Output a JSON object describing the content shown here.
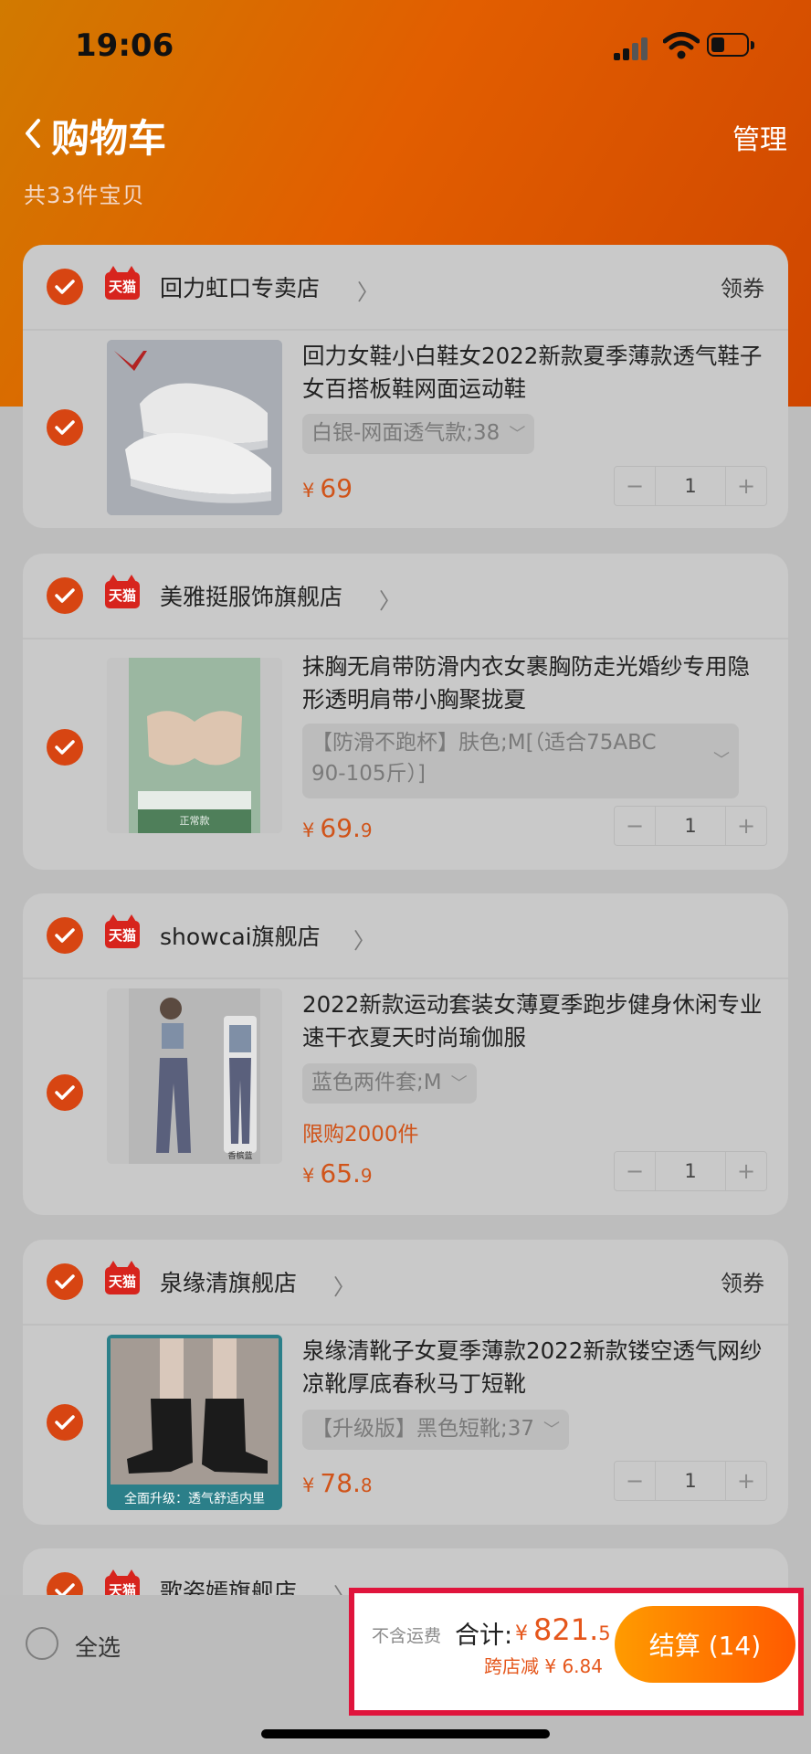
{
  "status_bar": {
    "time": "19:06"
  },
  "header": {
    "title": "购物车",
    "manage": "管理",
    "item_count": "共33件宝贝"
  },
  "shops": [
    {
      "name": "回力虹口专卖店",
      "badge": "天猫",
      "coupon": "领券",
      "item": {
        "title": "回力女鞋小白鞋女2022新款夏季薄款透气鞋子女百搭板鞋网面运动鞋",
        "spec": "白银-网面透气款;38",
        "price_symbol": "¥",
        "price_int": "69",
        "price_dec": "",
        "quantity": "1"
      }
    },
    {
      "name": "美雅挺服饰旗舰店",
      "badge": "天猫",
      "item": {
        "title": "抹胸无肩带防滑内衣女裹胸防走光婚纱专用隐形透明肩带小胸聚拢夏",
        "spec": "【防滑不跑杯】肤色;M[（适合75ABC 90-105斤）]",
        "price_symbol": "¥",
        "price_int": "69.",
        "price_dec": "9",
        "quantity": "1",
        "image_caption": "正常款"
      }
    },
    {
      "name": "showcai旗舰店",
      "badge": "天猫",
      "item": {
        "title": "2022新款运动套装女薄夏季跑步健身休闲专业速干衣夏天时尚瑜伽服",
        "spec": "蓝色两件套;M",
        "limit": "限购2000件",
        "price_symbol": "¥",
        "price_int": "65.",
        "price_dec": "9",
        "quantity": "1",
        "image_caption": "香槟蓝"
      }
    },
    {
      "name": "泉缘清旗舰店",
      "badge": "天猫",
      "coupon": "领券",
      "item": {
        "title": "泉缘清靴子女夏季薄款2022新款镂空透气网纱凉靴厚底春秋马丁短靴",
        "spec": "【升级版】黑色短靴;37",
        "price_symbol": "¥",
        "price_int": "78.",
        "price_dec": "8",
        "quantity": "1",
        "image_caption": "全面升级：透气舒适内里"
      }
    },
    {
      "name": "歌姿嫣旗舰店",
      "badge": "天猫"
    }
  ],
  "stepper": {
    "minus": "−",
    "plus": "+"
  },
  "bottom_bar": {
    "select_all": "全选",
    "shipping_note": "不含运费",
    "total_label": "合计:",
    "total_symbol": "¥",
    "total_int": "821.",
    "total_dec": "5",
    "discount": "跨店减 ¥ 6.84",
    "checkout": "结算 (14)"
  },
  "colors": {
    "accent": "#d74512",
    "price": "#d0541a",
    "checkout_gradient_start": "#ff9b00",
    "checkout_gradient_end": "#ff5a00",
    "highlight_border": "#e0143c"
  }
}
